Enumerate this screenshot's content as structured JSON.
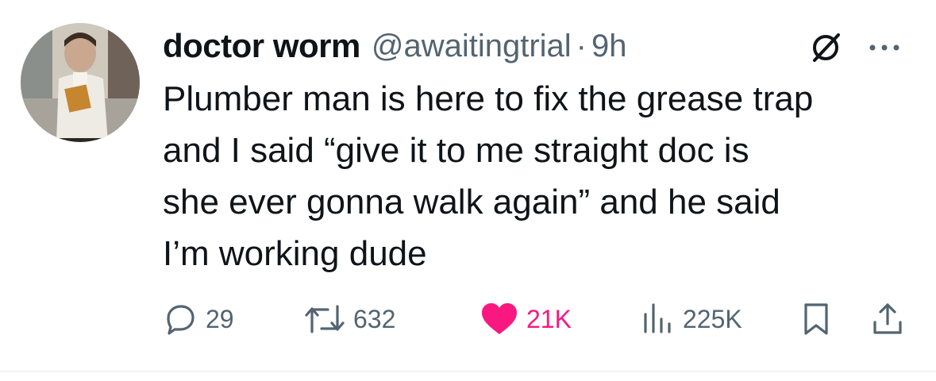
{
  "tweet": {
    "display_name": "doctor worm",
    "handle": "@awaitingtrial",
    "separator": "·",
    "time": "9h",
    "text_lines": [
      "Plumber man is here to fix the grease trap",
      "and I said “give it to me straight doc is",
      "she ever gonna walk again” and he said",
      "I’m working dude"
    ]
  },
  "actions": {
    "replies": "29",
    "reposts": "632",
    "likes": "21K",
    "views": "225K"
  },
  "icons": {
    "reply": "reply-icon",
    "repost": "repost-icon",
    "like": "heart-icon",
    "views": "views-icon",
    "bookmark": "bookmark-icon",
    "share": "share-icon",
    "more": "more-icon",
    "verified": "strikethrough-circle-icon"
  },
  "colors": {
    "text": "#0f1419",
    "secondary": "#536471",
    "like": "#f91880"
  }
}
